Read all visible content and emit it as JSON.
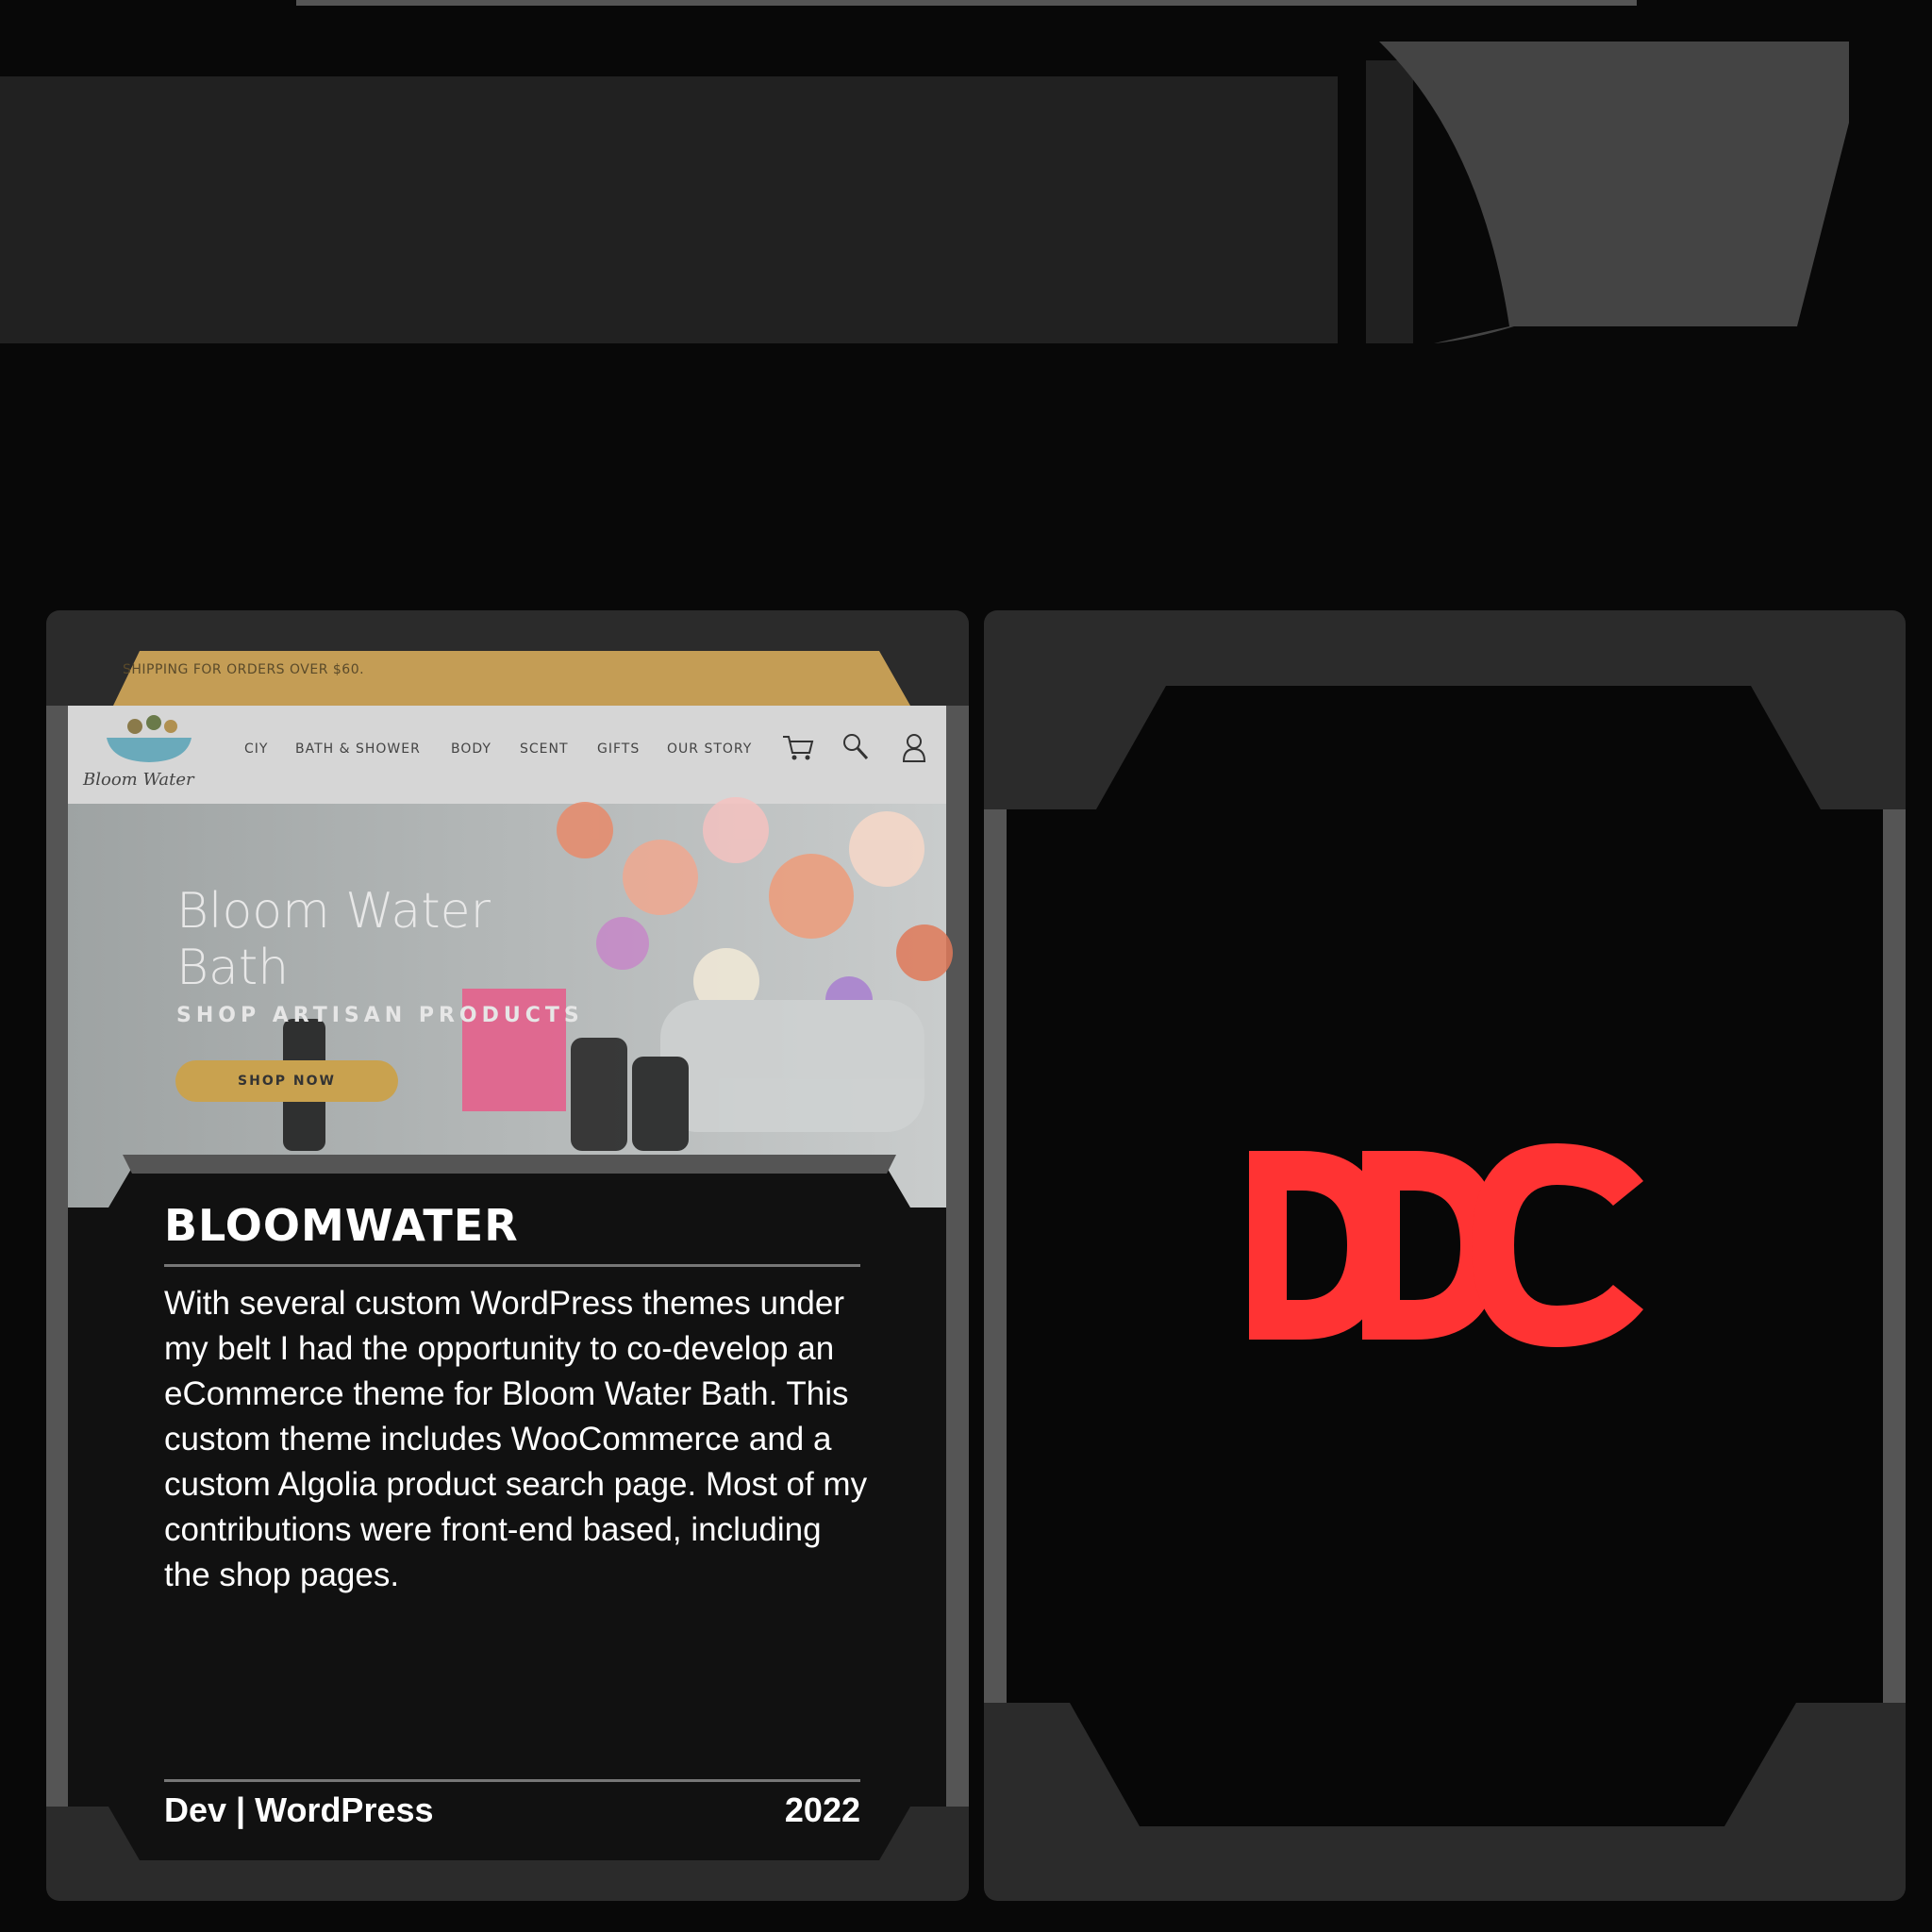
{
  "banner": {
    "text": "SHIPPING FOR ORDERS OVER $60."
  },
  "site": {
    "logo_text": "Bloom Water",
    "nav": [
      "CIY",
      "BATH & SHOWER",
      "BODY",
      "SCENT",
      "GIFTS",
      "OUR STORY"
    ],
    "hero_title_1": "Bloom Water",
    "hero_title_2": "Bath",
    "hero_subtitle": "SHOP ARTISAN PRODUCTS",
    "shop_button": "SHOP NOW"
  },
  "project": {
    "title": "BLOOMWATER",
    "description": "With several custom WordPress themes under my belt I had the opportunity to co-develop an eCommerce theme for Bloom Water Bath. This custom theme includes WooCommerce and a custom Algolia product search page. Most of my contributions were front-end based, including the shop pages.",
    "tags": "Dev | WordPress",
    "year": "2022"
  },
  "logo": {
    "text": "DDC",
    "color": "#ff3333"
  }
}
